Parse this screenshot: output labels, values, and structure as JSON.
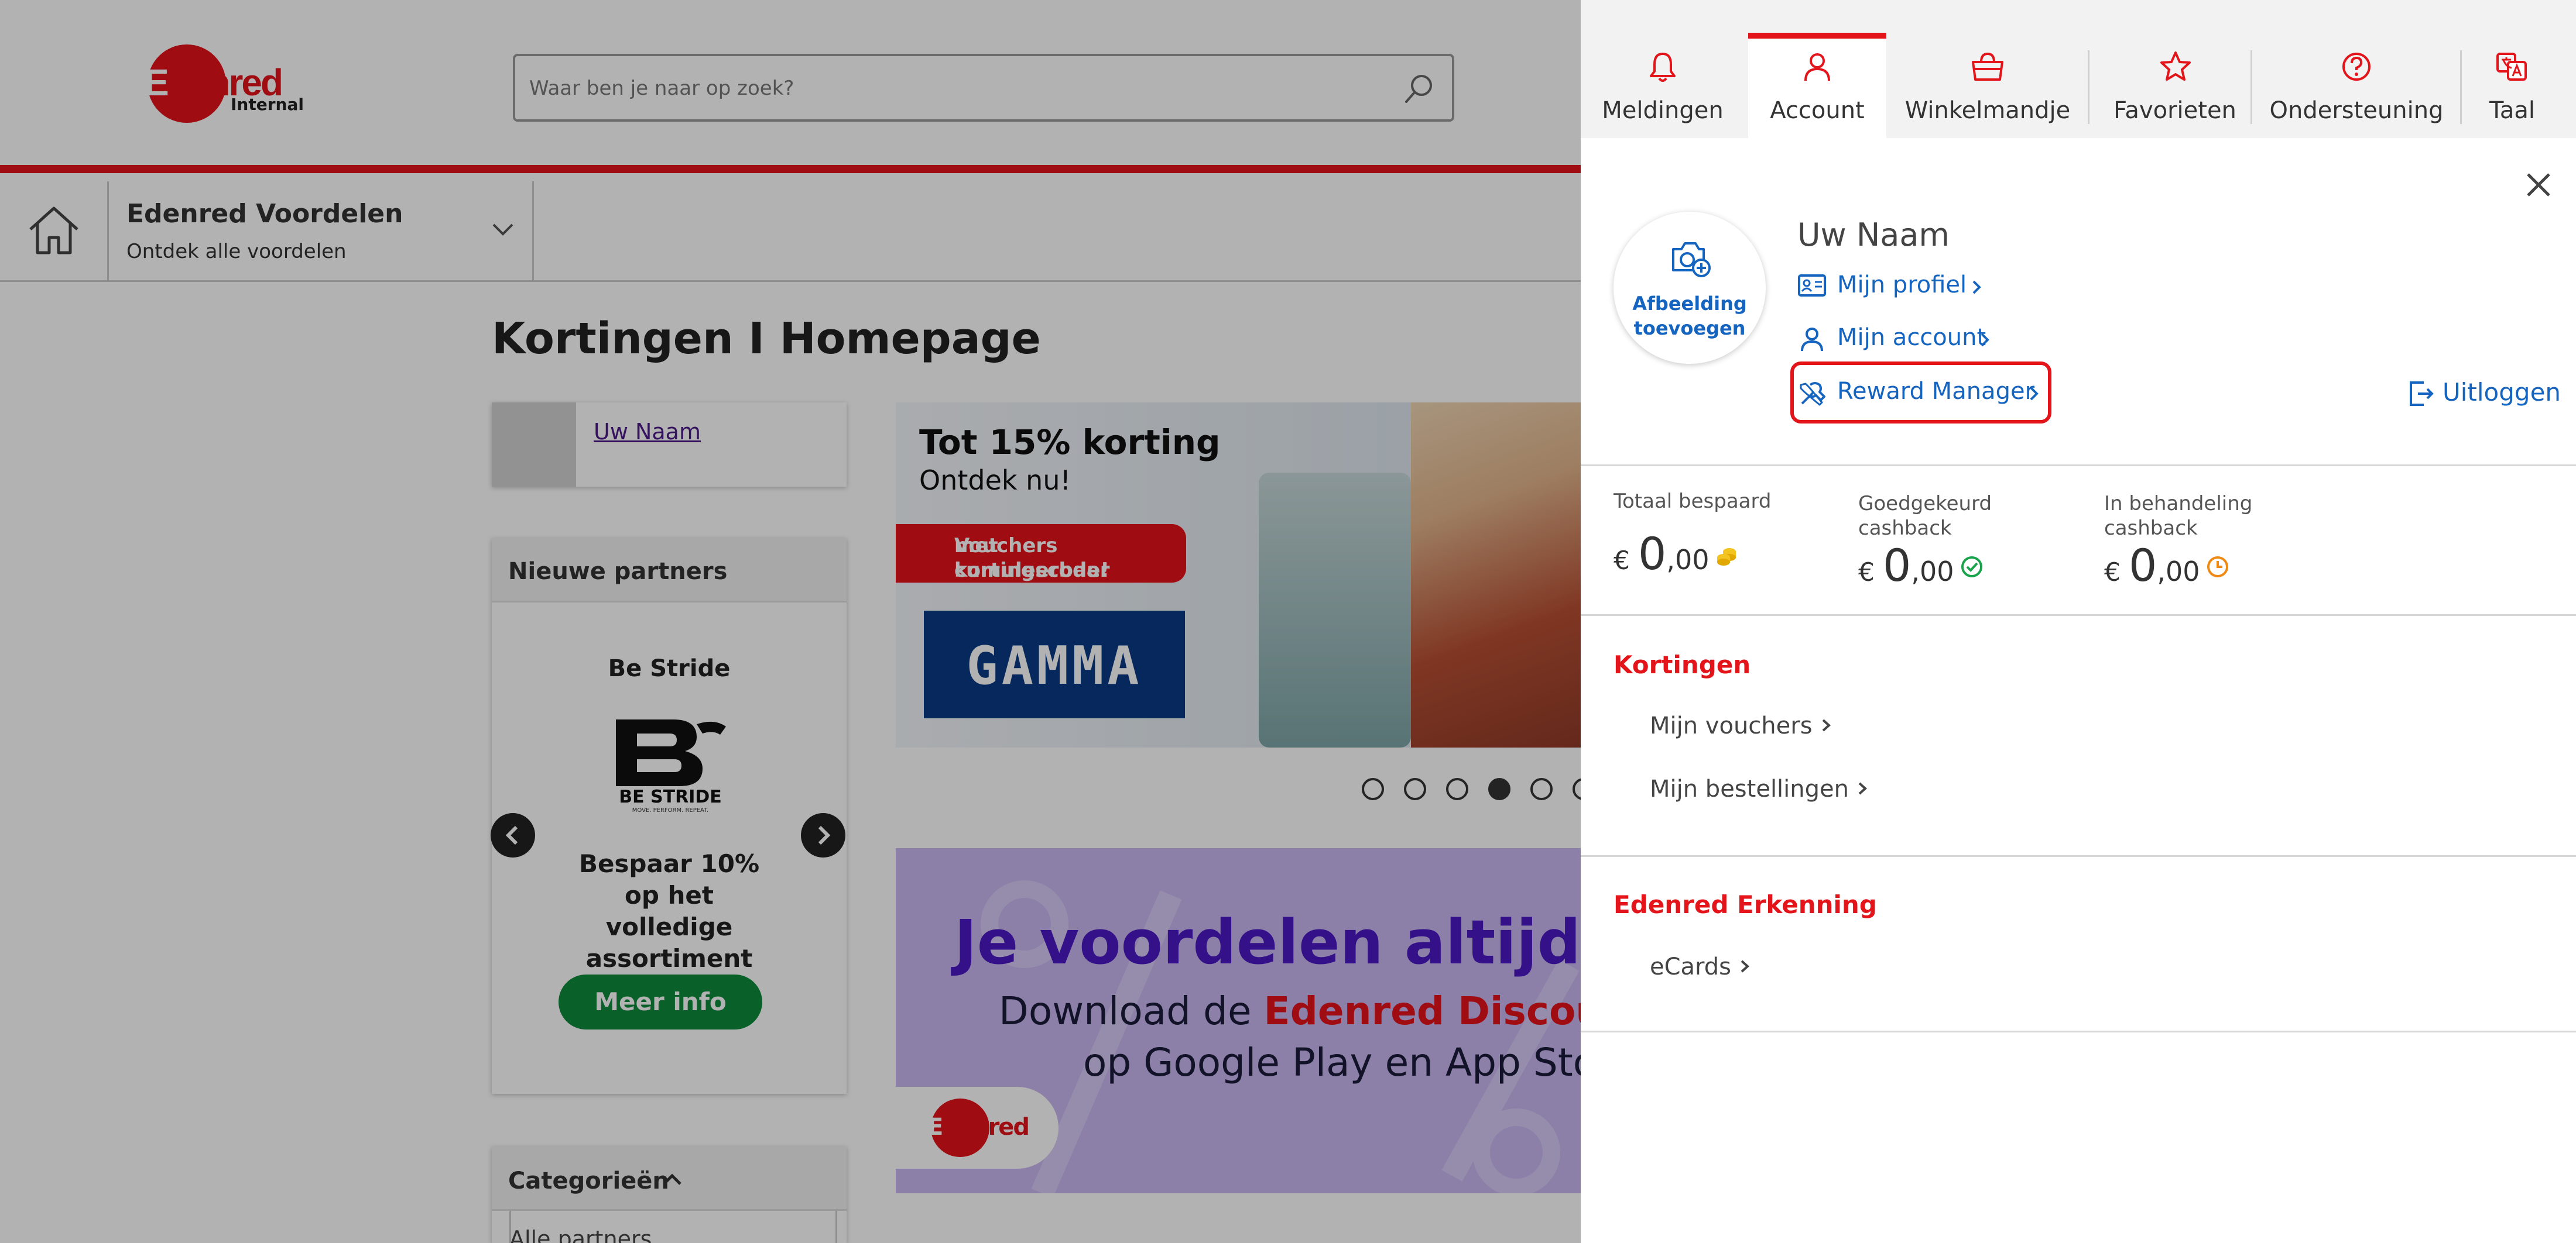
{
  "header": {
    "logo_word_first": "E",
    "logo_word_rest": "denred",
    "logo_sub": "Internal",
    "search_placeholder": "Waar ben je naar op zoek?"
  },
  "subnav": {
    "title": "Edenred Voordelen",
    "subtitle": "Ontdek alle voordelen"
  },
  "main": {
    "page_title": "Kortingen I Homepage",
    "user_card_name": "Uw Naam",
    "partners": {
      "heading": "Nieuwe partners",
      "name": "Be Stride",
      "logo_text": "BE STRIDE",
      "logo_tagline": "MOVE. PERFORM. REPEAT.",
      "description": "Bespaar 10% op het volledige assortiment",
      "button": "Meer info"
    },
    "categories": {
      "heading": "Categorieën",
      "first_item": "Alle partners"
    },
    "banner1": {
      "headline": "Tot 15% korting",
      "subline": "Ontdek nu!",
      "pill_line1": "Vouchers cumuleerbaar",
      "pill_line2": "met kortingscode!",
      "brand": "GAMMA"
    },
    "carousel": {
      "count": 6,
      "active": 3
    },
    "banner2": {
      "headline": "Je voordelen altijd op",
      "line2_a": "Download de ",
      "line2_b": "Edenred Discoun",
      "line3": "op Google Play en App Sto"
    }
  },
  "panel": {
    "tabs": [
      {
        "label": "Meldingen",
        "icon": "bell-icon"
      },
      {
        "label": "Account",
        "icon": "user-icon",
        "active": true
      },
      {
        "label": "Winkelmandje",
        "icon": "basket-icon"
      },
      {
        "label": "Favorieten",
        "icon": "star-icon"
      },
      {
        "label": "Ondersteuning",
        "icon": "help-icon"
      },
      {
        "label": "Taal",
        "icon": "translate-icon"
      }
    ],
    "photo_label_line1": "Afbeelding",
    "photo_label_line2": "toevoegen",
    "user_name": "Uw Naam",
    "links": {
      "profile": "Mijn profiel",
      "account": "Mijn account",
      "reward_manager": "Reward Manager"
    },
    "logout": "Uitloggen",
    "stats": [
      {
        "label_line1": "Totaal bespaard",
        "label_line2": "",
        "currency": "€",
        "int": "0",
        "dec": ",00",
        "icon": "coins-icon"
      },
      {
        "label_line1": "Goedgekeurd",
        "label_line2": "cashback",
        "currency": "€",
        "int": "0",
        "dec": ",00",
        "icon": "check-circle-icon"
      },
      {
        "label_line1": "In behandeling",
        "label_line2": "cashback",
        "currency": "€",
        "int": "0",
        "dec": ",00",
        "icon": "clock-icon"
      }
    ],
    "sections": {
      "kortingen": {
        "title": "Kortingen",
        "items": [
          "Mijn vouchers",
          "Mijn bestellingen"
        ]
      },
      "erkenning": {
        "title": "Edenred Erkenning",
        "items": [
          "eCards"
        ]
      }
    },
    "colors": {
      "brand_red": "#e4141b",
      "link_blue": "#1565c0",
      "cta_green": "#0d8a3a"
    }
  }
}
